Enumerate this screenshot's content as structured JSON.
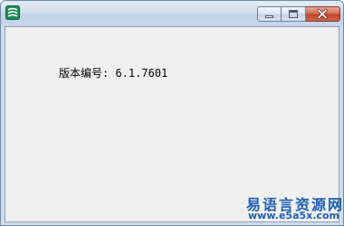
{
  "window": {
    "title": ""
  },
  "controls": {
    "minimize_icon": "minimize-icon",
    "maximize_icon": "maximize-icon",
    "close_icon": "close-icon"
  },
  "content": {
    "version_label": "版本编号: 6.1.7601"
  },
  "watermark": {
    "title": "易语言资源网",
    "url": "www.e5a5x.com"
  },
  "colors": {
    "watermark": "#1e5fb0",
    "close_button": "#c2432a",
    "client_background": "#f0f0f0"
  }
}
